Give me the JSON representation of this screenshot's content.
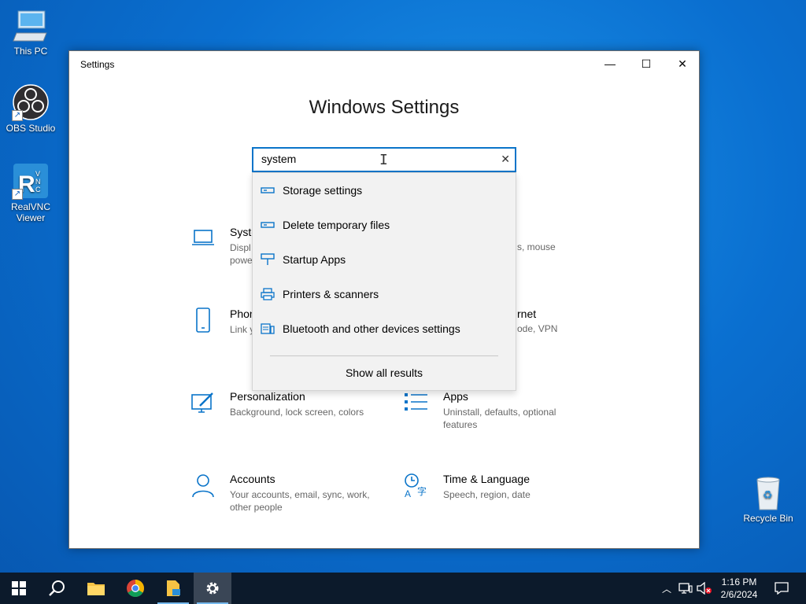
{
  "desktop": {
    "icons": [
      {
        "label": "This PC",
        "icon": "computer-icon"
      },
      {
        "label": "OBS Studio",
        "icon": "obs-icon"
      },
      {
        "label": "RealVNC Viewer",
        "icon": "realvnc-icon"
      },
      {
        "label": "Recycle Bin",
        "icon": "recycle-bin-icon"
      }
    ]
  },
  "window": {
    "title": "Settings",
    "heading": "Windows Settings",
    "controls": {
      "minimize": "—",
      "maximize": "☐",
      "close": "✕"
    }
  },
  "search": {
    "value": "system",
    "clear_icon": "✕"
  },
  "categories": [
    {
      "name": "Syste",
      "desc": "Displ\npowe",
      "icon": "laptop-icon",
      "desc_right": "s, mouse"
    },
    {
      "name": "Phon",
      "desc": "Link y",
      "icon": "phone-icon",
      "name_right": "rnet",
      "desc_right": "ode, VPN"
    },
    {
      "name": "Personalization",
      "desc": "Background, lock screen, colors",
      "icon": "personalization-icon"
    },
    {
      "name": "Apps",
      "desc": "Uninstall, defaults, optional features",
      "icon": "apps-icon"
    },
    {
      "name": "Accounts",
      "desc": "Your accounts, email, sync, work, other people",
      "icon": "accounts-icon"
    },
    {
      "name": "Time & Language",
      "desc": "Speech, region, date",
      "icon": "time-language-icon"
    }
  ],
  "dropdown": {
    "items": [
      {
        "label": "Storage settings",
        "icon": "storage-icon"
      },
      {
        "label": "Delete temporary files",
        "icon": "storage-icon"
      },
      {
        "label": "Startup Apps",
        "icon": "startup-icon"
      },
      {
        "label": "Printers & scanners",
        "icon": "printer-icon"
      },
      {
        "label": "Bluetooth and other devices settings",
        "icon": "devices-icon"
      }
    ],
    "show_all": "Show all results"
  },
  "taskbar": {
    "time": "1:16 PM",
    "date": "2/6/2024"
  },
  "colors": {
    "accent": "#0a74c9",
    "taskbar": "#0c1a2b"
  }
}
